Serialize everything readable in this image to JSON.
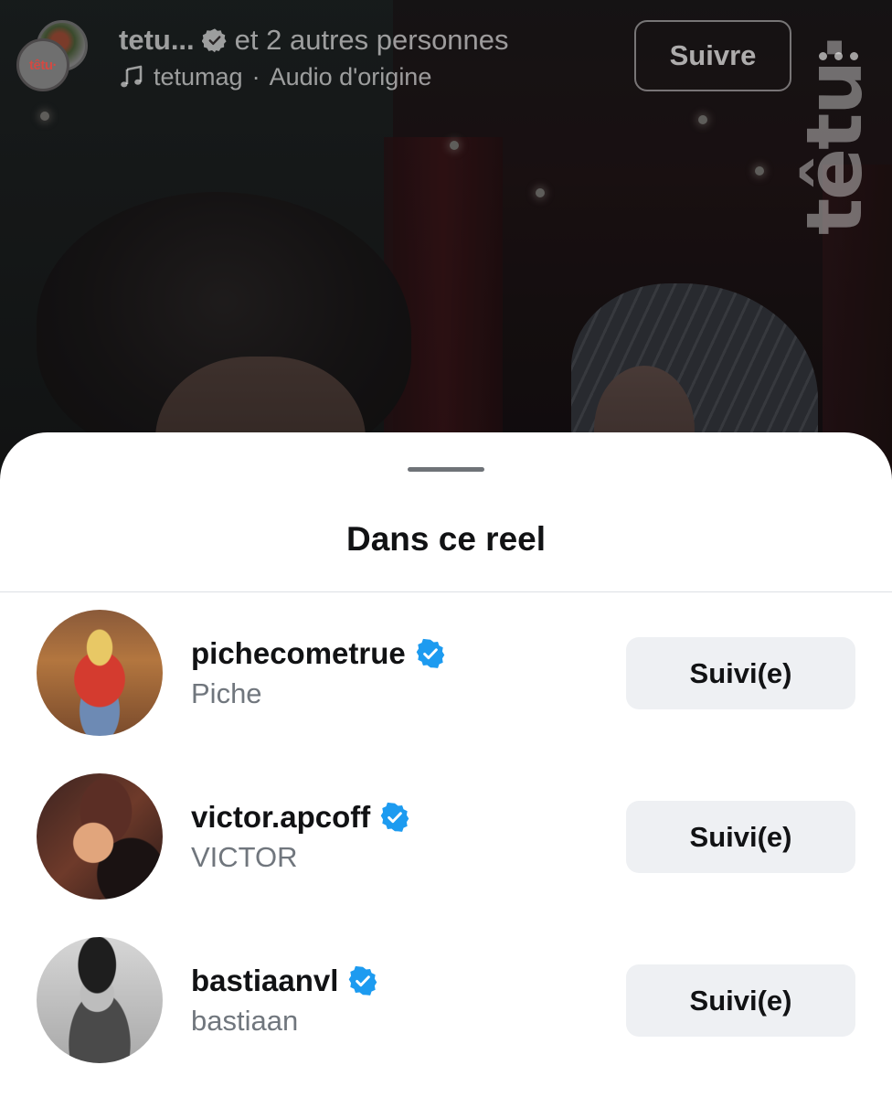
{
  "reel": {
    "account_name": "tetu...",
    "tagged_others": "et 2 autres personnes",
    "audio_account": "tetumag",
    "audio_separator": "·",
    "audio_label": "Audio d'origine",
    "follow_label": "Suivre",
    "watermark": "têtu·",
    "avatar_logo_text": "têtu·"
  },
  "sheet": {
    "title": "Dans ce reel",
    "people": [
      {
        "username": "pichecometrue",
        "fullname": "Piche",
        "status_label": "Suivi(e)",
        "verified": true
      },
      {
        "username": "victor.apcoff",
        "fullname": "VICTOR",
        "status_label": "Suivi(e)",
        "verified": true
      },
      {
        "username": "bastiaanvl",
        "fullname": "bastiaan",
        "status_label": "Suivi(e)",
        "verified": true
      }
    ]
  },
  "colors": {
    "verified_blue": "#1d9bf0",
    "sheet_background": "#ffffff",
    "button_background": "#eef0f3"
  },
  "icons": [
    "verified-badge-icon",
    "music-note-icon",
    "more-options-icon"
  ]
}
